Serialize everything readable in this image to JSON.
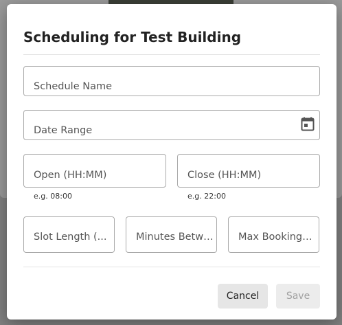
{
  "dialog": {
    "title": "Scheduling for Test Building"
  },
  "fields": {
    "schedule_name": {
      "label": "Schedule Name"
    },
    "date_range": {
      "label": "Date Range",
      "icon": "calendar-icon"
    },
    "open_time": {
      "label": "Open (HH:MM)",
      "helper": "e.g. 08:00"
    },
    "close_time": {
      "label": "Close (HH:MM)",
      "helper": "e.g. 22:00"
    },
    "slot_length": {
      "label": "Slot Length (..."
    },
    "minutes_between": {
      "label": "Minutes Betwe..."
    },
    "max_bookings": {
      "label": "Max Bookings ..."
    }
  },
  "actions": {
    "cancel_label": "Cancel",
    "save_label": "Save",
    "save_disabled": true
  },
  "colors": {
    "backdrop": "#818181",
    "dialog_bg": "#ffffff",
    "field_border": "#a9a9a9",
    "cancel_bg": "#e6e6e6",
    "save_bg_disabled": "#ececec"
  }
}
